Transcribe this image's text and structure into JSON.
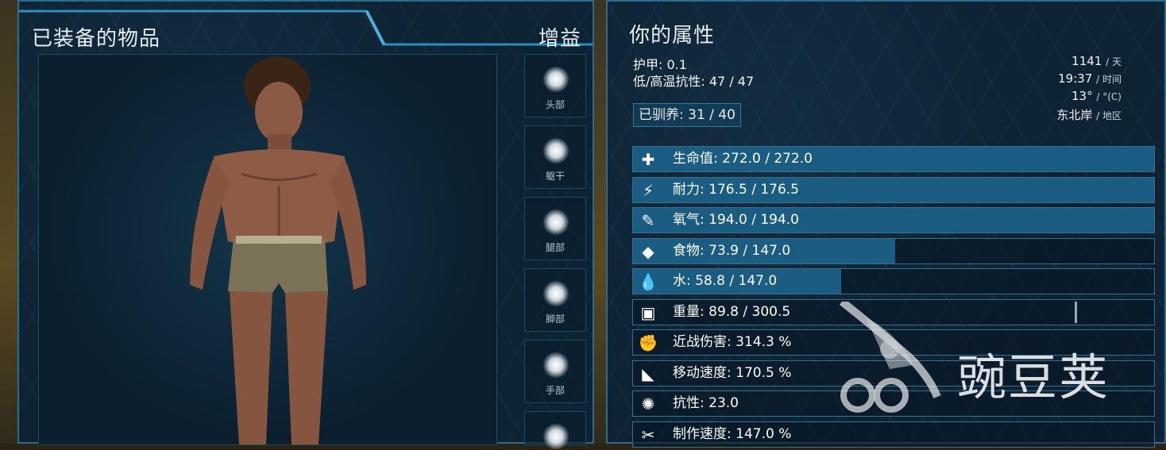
{
  "left_panel": {
    "title": "已装备的物品",
    "tab_label": "增益",
    "slots": [
      {
        "label": "头部"
      },
      {
        "label": "躯干"
      },
      {
        "label": "腿部"
      },
      {
        "label": "脚部"
      },
      {
        "label": "手部"
      },
      {
        "label": ""
      }
    ]
  },
  "right_panel": {
    "title": "你的属性",
    "armor": "护甲: 0.1",
    "temp_resist": "低/高温抗性: 47 / 47",
    "tamed": "已驯养: 31 / 40",
    "info": {
      "day_value": "1141",
      "day_unit": "/ 天",
      "time_value": "19:37",
      "time_unit": "/ 时间",
      "temp_value": "13°",
      "temp_unit": "/ °(C)",
      "region_value": "东北岸",
      "region_unit": "/ 地区"
    },
    "stats": [
      {
        "icon": "health-cross-icon",
        "label": "生命值: 272.0 / 272.0",
        "fill": 1.0
      },
      {
        "icon": "stamina-bolt-icon",
        "label": "耐力: 176.5 / 176.5",
        "fill": 1.0
      },
      {
        "icon": "oxygen-tank-icon",
        "label": "氧气: 194.0 / 194.0",
        "fill": 1.0
      },
      {
        "icon": "food-meat-icon",
        "label": "食物: 73.9 / 147.0",
        "fill": 0.503
      },
      {
        "icon": "water-drop-icon",
        "label": "水: 58.8 / 147.0",
        "fill": 0.4
      },
      {
        "icon": "weight-icon",
        "label": "重量: 89.8 / 300.5",
        "fill": 0.0
      },
      {
        "icon": "melee-fist-icon",
        "label": "近战伤害: 314.3 %",
        "fill": 0.0
      },
      {
        "icon": "movement-boot-icon",
        "label": "移动速度: 170.5 %",
        "fill": 0.0
      },
      {
        "icon": "fortitude-brain-icon",
        "label": "抗性: 23.0",
        "fill": 0.0
      },
      {
        "icon": "crafting-tools-icon",
        "label": "制作速度: 147.0 %",
        "fill": 0.0
      }
    ]
  },
  "watermark": {
    "text": "豌豆荚"
  },
  "colors": {
    "panel_bg": "#0d2233",
    "border": "#2c6c8c",
    "bar_fill": "#1a5c82"
  }
}
